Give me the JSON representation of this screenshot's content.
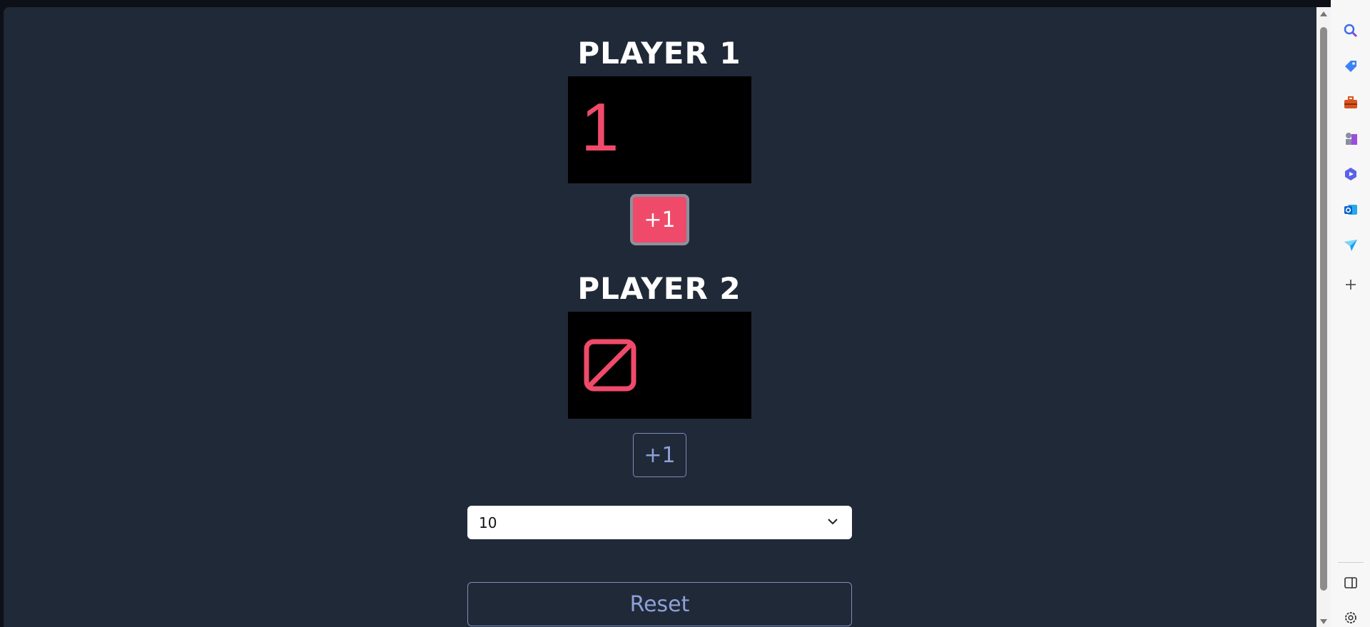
{
  "players": [
    {
      "title": "PLAYER 1",
      "score": "1",
      "button_label": "+1"
    },
    {
      "title": "PLAYER 2",
      "score": "0",
      "button_label": "+1"
    }
  ],
  "settings": {
    "selected_value": "10"
  },
  "reset_label": "Reset",
  "sidebar": {
    "icons": [
      "search-icon",
      "tag-icon",
      "toolbox-icon",
      "chess-icon",
      "copilot-icon",
      "outlook-icon",
      "send-icon",
      "add-icon"
    ],
    "bottom_icons": [
      "sidebar-toggle-icon",
      "settings-icon"
    ]
  },
  "colors": {
    "accent": "#f04a6a",
    "page_bg": "#202938",
    "outline": "#7c8db8"
  }
}
